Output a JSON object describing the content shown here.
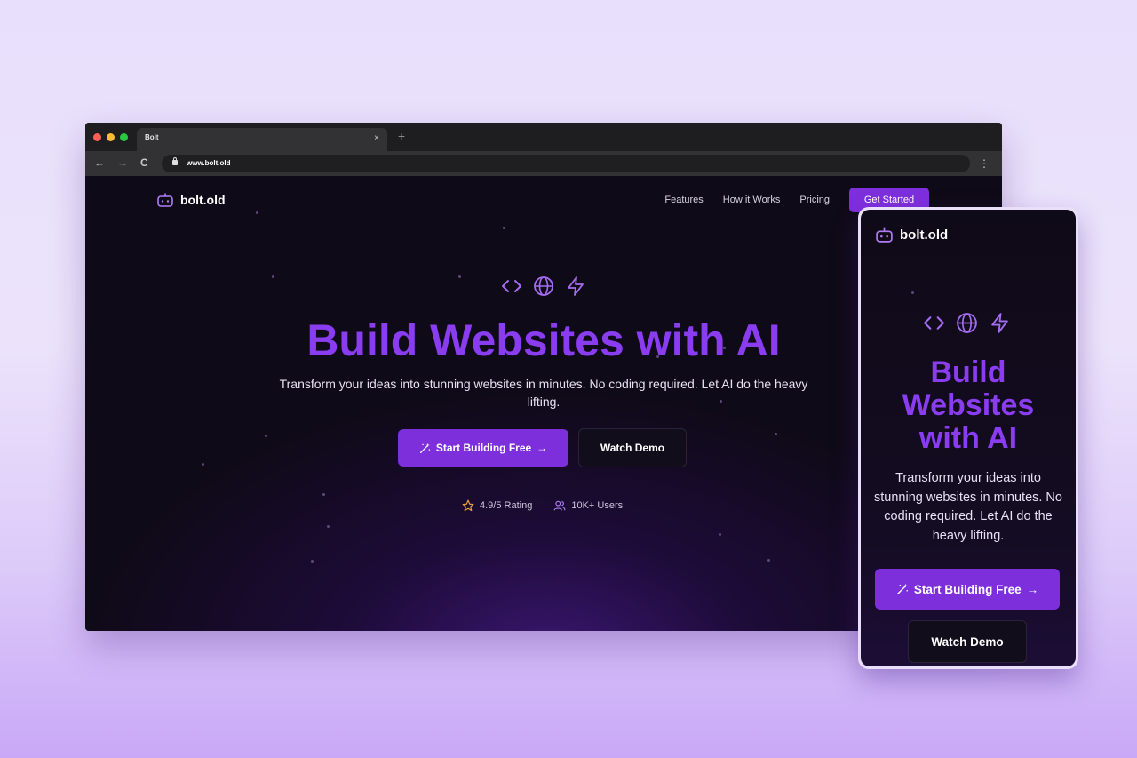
{
  "browser": {
    "tab_title": "Bolt",
    "tab_close": "×",
    "new_tab": "+",
    "back": "←",
    "forward": "→",
    "reload": "C",
    "url": "www.bolt.old",
    "menu": "⋮",
    "traffic_lights": [
      "#ff5f57",
      "#febc2e",
      "#28c840"
    ]
  },
  "site": {
    "brand": "bolt.old",
    "nav": [
      "Features",
      "How it Works",
      "Pricing"
    ],
    "cta": "Get Started",
    "hero_icons": [
      "code-icon",
      "globe-icon",
      "zap-icon"
    ],
    "title": "Build Websites with AI",
    "subtitle": "Transform your ideas into stunning websites in minutes. No coding required. Let AI do the heavy lifting.",
    "primary_button": "Start Building Free",
    "secondary_button": "Watch Demo",
    "stats": [
      {
        "icon": "star-icon",
        "label": "4.9/5 Rating"
      },
      {
        "icon": "users-icon",
        "label": "10K+ Users"
      }
    ],
    "accent_color": "#7e2fdc"
  },
  "phone": {
    "brand": "bolt.old",
    "title_lines": [
      "Build",
      "Websites",
      "with AI"
    ],
    "subtitle": "Transform your ideas into stunning websites in minutes. No coding required. Let AI do the heavy lifting.",
    "primary_button": "Start Building Free",
    "secondary_button": "Watch Demo"
  }
}
